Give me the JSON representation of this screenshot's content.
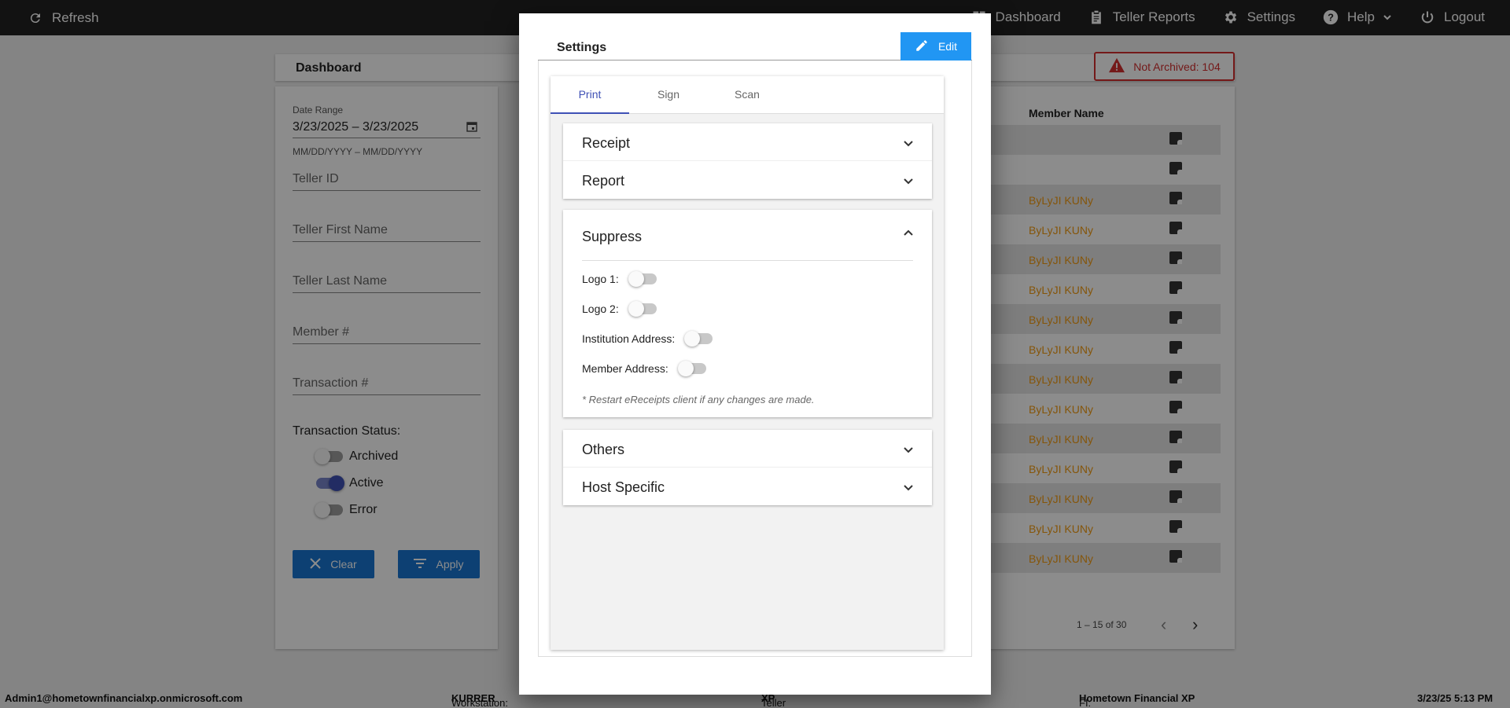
{
  "topbar": {
    "refresh_label": "Refresh",
    "nav": [
      {
        "label": "Dashboard",
        "icon": "dashboard-icon"
      },
      {
        "label": "Teller Reports",
        "icon": "clipboard-icon"
      },
      {
        "label": "Settings",
        "icon": "gear-icon"
      },
      {
        "label": "Help",
        "icon": "help-icon"
      },
      {
        "label": "Logout",
        "icon": "power-icon"
      }
    ]
  },
  "dashboard": {
    "title": "Dashboard",
    "date_range_label": "Date Range",
    "date_range_value": "3/23/2025 – 3/23/2025",
    "date_hint": "MM/DD/YYYY – MM/DD/YYYY",
    "fields": [
      "Teller ID",
      "Teller First Name",
      "Teller Last Name",
      "Member #",
      "Transaction #"
    ],
    "status_title": "Transaction Status:",
    "statuses": [
      {
        "label": "Archived",
        "on": false
      },
      {
        "label": "Active",
        "on": true
      },
      {
        "label": "Error",
        "on": false
      }
    ],
    "clear_label": "Clear",
    "apply_label": "Apply",
    "not_archived": "Not Archived: 104",
    "table_header": "Member Name",
    "rows": [
      "",
      "",
      "ByLyJI KUNy",
      "ByLyJI KUNy",
      "ByLyJI KUNy",
      "ByLyJI KUNy",
      "ByLyJI KUNy",
      "ByLyJI KUNy",
      "ByLyJI KUNy",
      "ByLyJI KUNy",
      "ByLyJI KUNy",
      "ByLyJI KUNy",
      "ByLyJI KUNy",
      "ByLyJI KUNy",
      "ByLyJI KUNy"
    ],
    "pager": "1 – 15 of 30"
  },
  "statusbar": {
    "user": "Admin1@hometownfinancialxp.onmicrosoft.com",
    "workstation_label": "Workstation:",
    "workstation": "KURRER",
    "platform_label": "Teller Platform:",
    "platform": "XP",
    "fi_label": "FI:",
    "fi": "Hometown Financial XP",
    "datetime": "3/23/25 5:13 PM"
  },
  "modal": {
    "title": "Settings",
    "edit_label": "Edit",
    "tabs": [
      "Print",
      "Sign",
      "Scan"
    ],
    "active_tab": "Print",
    "panels_top": [
      "Receipt",
      "Report"
    ],
    "suppress": {
      "title": "Suppress",
      "options": [
        {
          "label": "Logo 1:",
          "on": false
        },
        {
          "label": "Logo 2:",
          "on": false
        },
        {
          "label": "Institution Address:",
          "on": false
        },
        {
          "label": "Member Address:",
          "on": false
        }
      ],
      "note": "* Restart eReceipts client if any changes are made."
    },
    "panels_bottom": [
      "Others",
      "Host Specific"
    ]
  },
  "colors": {
    "accent": "#3f51b5",
    "button_blue": "#1976d2",
    "edit_blue": "#2196f3",
    "warning_red": "#d32f2f",
    "member_name_orange": "#f39c12"
  }
}
